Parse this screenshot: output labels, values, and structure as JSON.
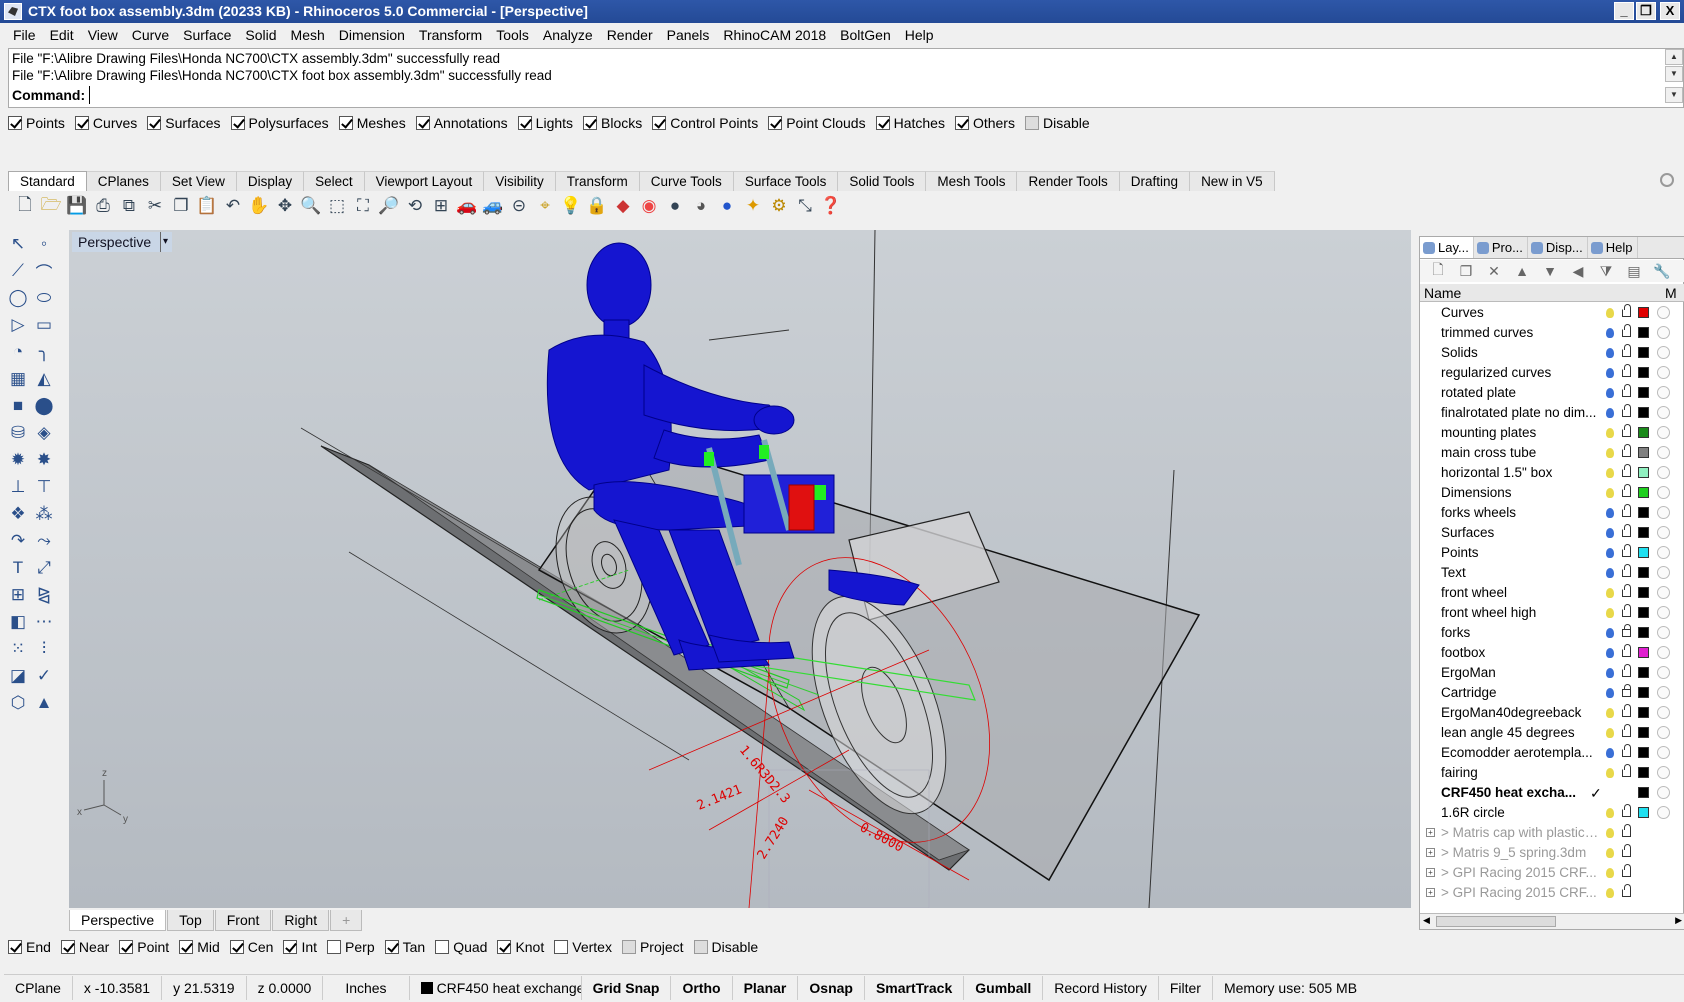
{
  "window": {
    "title": "CTX foot box assembly.3dm (20233 KB) - Rhinoceros 5.0 Commercial - [Perspective]",
    "buttons": [
      "_",
      "❐",
      "X"
    ]
  },
  "menu": [
    "File",
    "Edit",
    "View",
    "Curve",
    "Surface",
    "Solid",
    "Mesh",
    "Dimension",
    "Transform",
    "Tools",
    "Analyze",
    "Render",
    "Panels",
    "RhinoCAM 2018",
    "BoltGen",
    "Help"
  ],
  "command": {
    "history": [
      "File \"F:\\Alibre Drawing Files\\Honda NC700\\CTX assembly.3dm\" successfully read",
      "File \"F:\\Alibre Drawing Files\\Honda NC700\\CTX foot box assembly.3dm\" successfully read"
    ],
    "label": "Command:",
    "value": ""
  },
  "select_filter": [
    {
      "label": "Points",
      "checked": true
    },
    {
      "label": "Curves",
      "checked": true
    },
    {
      "label": "Surfaces",
      "checked": true
    },
    {
      "label": "Polysurfaces",
      "checked": true
    },
    {
      "label": "Meshes",
      "checked": true
    },
    {
      "label": "Annotations",
      "checked": true
    },
    {
      "label": "Lights",
      "checked": true
    },
    {
      "label": "Blocks",
      "checked": true
    },
    {
      "label": "Control Points",
      "checked": true
    },
    {
      "label": "Point Clouds",
      "checked": true
    },
    {
      "label": "Hatches",
      "checked": true
    },
    {
      "label": "Others",
      "checked": true
    },
    {
      "label": "Disable",
      "checked": false
    }
  ],
  "toolbar_tabs": [
    "Standard",
    "CPlanes",
    "Set View",
    "Display",
    "Select",
    "Viewport Layout",
    "Visibility",
    "Transform",
    "Curve Tools",
    "Surface Tools",
    "Solid Tools",
    "Mesh Tools",
    "Render Tools",
    "Drafting",
    "New in V5"
  ],
  "active_tab": "Standard",
  "viewport": {
    "title": "Perspective",
    "axes": {
      "x": "x",
      "y": "y",
      "z": "z"
    },
    "dimension_texts": [
      "1.6R3D2.3",
      "2.1421",
      "2.7240",
      "0.8000"
    ]
  },
  "viewport_tabs": [
    "Perspective",
    "Top",
    "Front",
    "Right",
    "+"
  ],
  "osnaps": [
    {
      "label": "End",
      "checked": true
    },
    {
      "label": "Near",
      "checked": true
    },
    {
      "label": "Point",
      "checked": true
    },
    {
      "label": "Mid",
      "checked": true
    },
    {
      "label": "Cen",
      "checked": true
    },
    {
      "label": "Int",
      "checked": true
    },
    {
      "label": "Perp",
      "checked": false
    },
    {
      "label": "Tan",
      "checked": true
    },
    {
      "label": "Quad",
      "checked": false
    },
    {
      "label": "Knot",
      "checked": true
    },
    {
      "label": "Vertex",
      "checked": false
    },
    {
      "label": "Project",
      "checked": false
    },
    {
      "label": "Disable",
      "checked": false
    }
  ],
  "status": {
    "cplane": "CPlane",
    "x": "x -10.3581",
    "y": "y 21.5319",
    "z": "z 0.0000",
    "units": "Inches",
    "layer": "CRF450 heat exchange",
    "grid_snap": "Grid Snap",
    "ortho": "Ortho",
    "planar": "Planar",
    "osnap": "Osnap",
    "smarttrack": "SmartTrack",
    "gumball": "Gumball",
    "record_history": "Record History",
    "filter": "Filter",
    "memory": "Memory use: 505 MB"
  },
  "panel": {
    "tabs": [
      "Lay...",
      "Pro...",
      "Disp...",
      "Help"
    ],
    "header_name": "Name",
    "header_m": "M",
    "layers": [
      {
        "name": "Curves",
        "color": "#e00000",
        "bulb": "#e8d84a",
        "locked": false
      },
      {
        "name": "trimmed curves",
        "color": "#000000",
        "bulb": "#3a6fd6",
        "locked": false
      },
      {
        "name": "Solids",
        "color": "#000000",
        "bulb": "#3a6fd6",
        "locked": false
      },
      {
        "name": "regularized curves",
        "color": "#000000",
        "bulb": "#3a6fd6",
        "locked": false
      },
      {
        "name": "rotated plate",
        "color": "#000000",
        "bulb": "#3a6fd6",
        "locked": false
      },
      {
        "name": "finalrotated plate no dim...",
        "color": "#000000",
        "bulb": "#3a6fd6",
        "locked": false
      },
      {
        "name": "mounting plates",
        "color": "#1b8a1b",
        "bulb": "#e8d84a",
        "locked": false
      },
      {
        "name": "main cross tube",
        "color": "#808080",
        "bulb": "#e8d84a",
        "locked": false
      },
      {
        "name": "horizontal 1.5\" box",
        "color": "#90f0c0",
        "bulb": "#e8d84a",
        "locked": false
      },
      {
        "name": "Dimensions",
        "color": "#20d020",
        "bulb": "#e8d84a",
        "locked": false
      },
      {
        "name": "forks wheels",
        "color": "#000000",
        "bulb": "#3a6fd6",
        "locked": false
      },
      {
        "name": "Surfaces",
        "color": "#000000",
        "bulb": "#3a6fd6",
        "locked": false
      },
      {
        "name": "Points",
        "color": "#20e0f0",
        "bulb": "#3a6fd6",
        "locked": false
      },
      {
        "name": "Text",
        "color": "#000000",
        "bulb": "#3a6fd6",
        "locked": false
      },
      {
        "name": "front wheel",
        "color": "#000000",
        "bulb": "#e8d84a",
        "locked": false
      },
      {
        "name": "front wheel high",
        "color": "#000000",
        "bulb": "#e8d84a",
        "locked": false
      },
      {
        "name": "forks",
        "color": "#000000",
        "bulb": "#3a6fd6",
        "locked": true
      },
      {
        "name": "footbox",
        "color": "#e020d0",
        "bulb": "#3a6fd6",
        "locked": false
      },
      {
        "name": "ErgoMan",
        "color": "#000000",
        "bulb": "#3a6fd6",
        "locked": false
      },
      {
        "name": "Cartridge",
        "color": "#000000",
        "bulb": "#3a6fd6",
        "locked": true
      },
      {
        "name": "ErgoMan40degreeback",
        "color": "#000000",
        "bulb": "#e8d84a",
        "locked": false
      },
      {
        "name": "lean angle 45 degrees",
        "color": "#000000",
        "bulb": "#e8d84a",
        "locked": false
      },
      {
        "name": "Ecomodder aerotempla...",
        "color": "#000000",
        "bulb": "#3a6fd6",
        "locked": false
      },
      {
        "name": "fairing",
        "color": "#000000",
        "bulb": "#e8d84a",
        "locked": false
      },
      {
        "name": "CRF450 heat excha...",
        "color": "#000000",
        "current": true,
        "check": "✓"
      },
      {
        "name": "1.6R circle",
        "color": "#20e0f0",
        "bulb": "#e8d84a",
        "locked": false
      },
      {
        "name": "> Matris cap with plastic ...",
        "ref": true,
        "bulb": "#e8d84a"
      },
      {
        "name": "> Matris 9_5 spring.3dm",
        "ref": true,
        "bulb": "#e8d84a"
      },
      {
        "name": "> GPI Racing 2015 CRF...",
        "ref": true,
        "bulb": "#e8d84a"
      },
      {
        "name": "> GPI Racing 2015 CRF...",
        "ref": true,
        "bulb": "#e8d84a"
      }
    ]
  }
}
